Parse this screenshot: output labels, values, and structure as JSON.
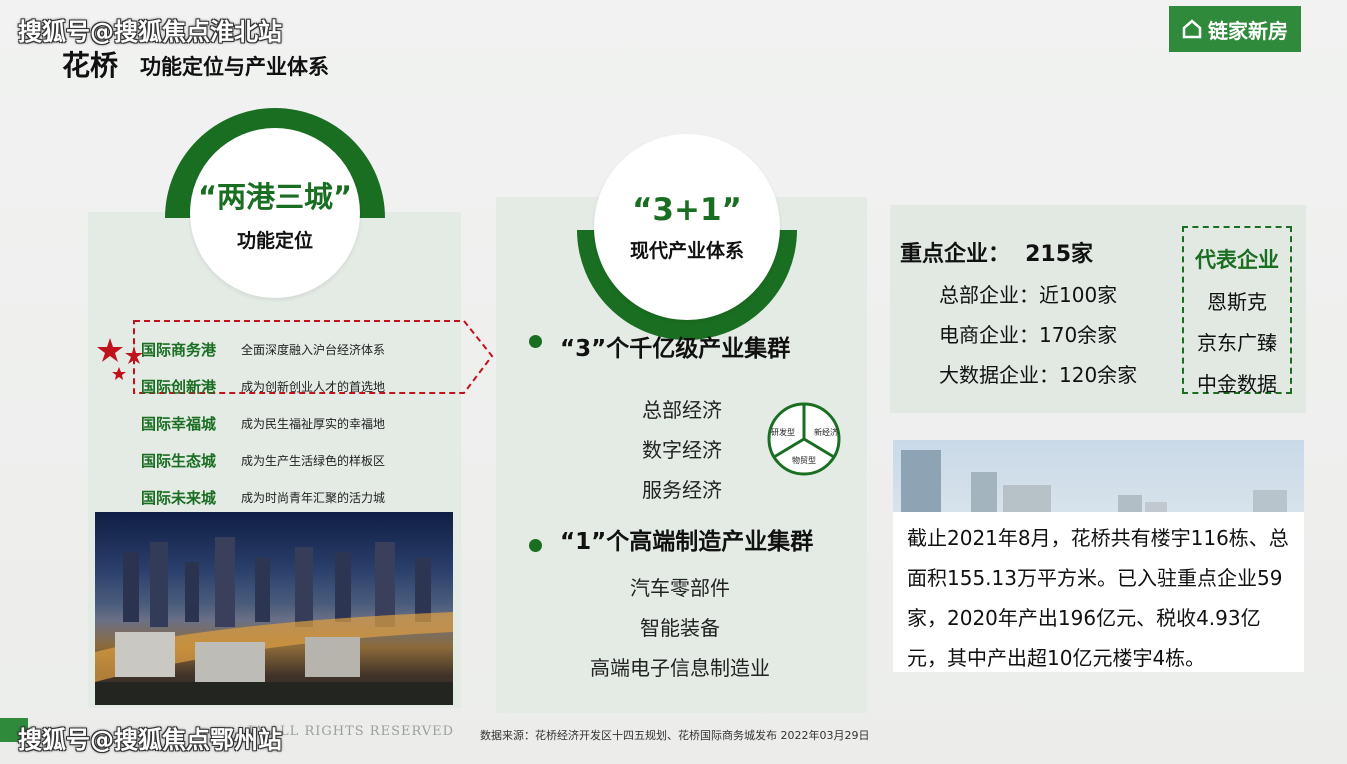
{
  "watermarks": {
    "top": "搜狐号@搜狐焦点淮北站",
    "bottom": "搜狐号@搜狐焦点鄂州站",
    "copyright": "IA ALL RIGHTS RESERVED"
  },
  "header": {
    "title": "花桥",
    "subtitle": "功能定位与产业体系"
  },
  "logo": {
    "text": "链家新房",
    "icon": "house-icon"
  },
  "left": {
    "circle_title": "“两港三城”",
    "circle_sub": "功能定位",
    "items": [
      {
        "name": "国际商务港",
        "desc": "全面深度融入沪台经济体系"
      },
      {
        "name": "国际创新港",
        "desc": "成为创新创业人才的首选地"
      },
      {
        "name": "国际幸福城",
        "desc": "成为民生福祉厚实的幸福地"
      },
      {
        "name": "国际生态城",
        "desc": "成为生产生活绿色的样板区"
      },
      {
        "name": "国际未来城",
        "desc": "成为时尚青年汇聚的活力城"
      }
    ]
  },
  "middle": {
    "circle_title": "“3+1”",
    "circle_sub": "现代产业体系",
    "group1": {
      "title": "“3”个千亿级产业集群",
      "items": [
        "总部经济",
        "数字经济",
        "服务经济"
      ]
    },
    "pie": [
      "研发型",
      "新经济",
      "物贸型"
    ],
    "group2": {
      "title": "“1”个高端制造产业集群",
      "items": [
        "汽车零部件",
        "智能装备",
        "高端电子信息制造业"
      ]
    }
  },
  "right": {
    "key_title": "重点企业：",
    "key_count": "215家",
    "lines": [
      "总部企业：近100家",
      "电商企业：170余家",
      "大数据企业：120余家"
    ],
    "rep_title": "代表企业",
    "rep_items": [
      "恩斯克",
      "京东广臻",
      "中金数据"
    ],
    "summary": "截止2021年8月，花桥共有楼宇116栋、总面积155.13万平方米。已入驻重点企业59家，2020年产出196亿元、税收4.93亿元，其中产出超10亿元楼宇4栋。"
  },
  "footer": {
    "source": "数据来源：花桥经济开发区十四五规划、花桥国际商务城发布 2022年03月29日"
  },
  "colors": {
    "green": "#1a6e22",
    "red": "#c0121b",
    "logo_bg": "#2f8a3c"
  }
}
